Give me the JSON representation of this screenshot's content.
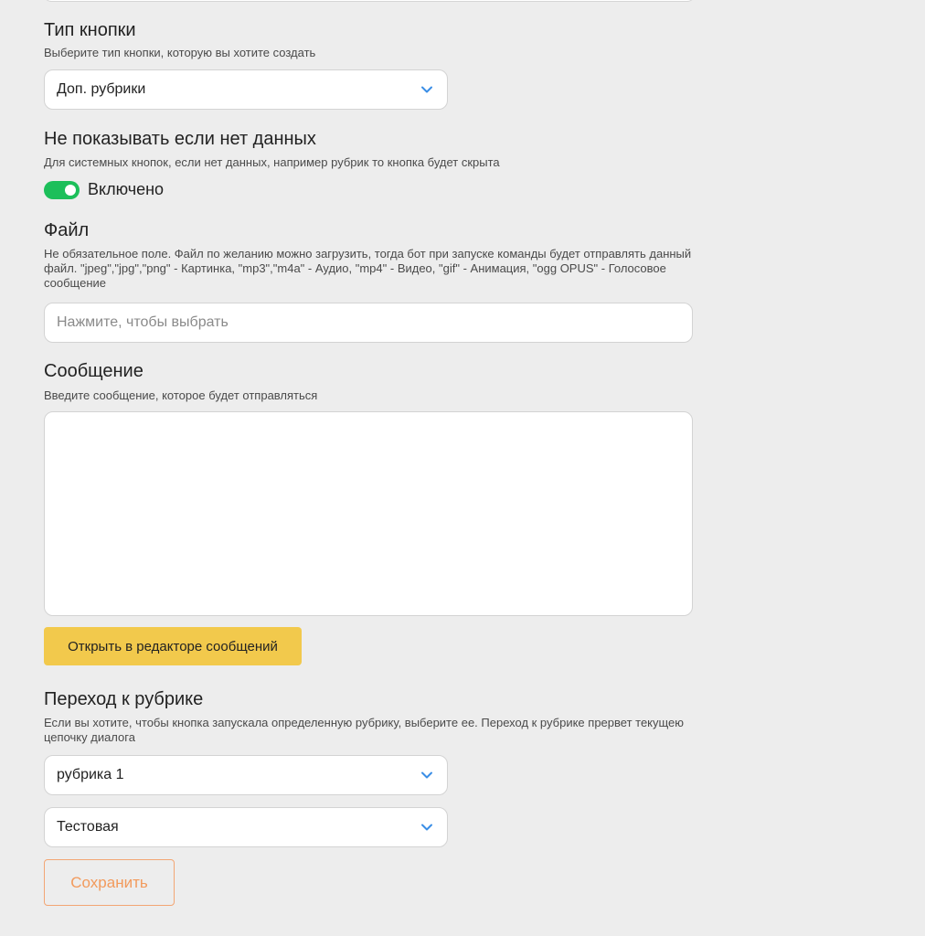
{
  "button_type": {
    "title": "Тип кнопки",
    "description": "Выберите тип кнопки, которую вы хотите создать",
    "selected": "Доп. рубрики"
  },
  "hide_if_empty": {
    "title": "Не показывать если нет данных",
    "description": "Для системных кнопок, если нет данных, например рубрик то кнопка будет скрыта",
    "toggle_on": true,
    "toggle_label": "Включено"
  },
  "file": {
    "title": "Файл",
    "description_line1": "Не обязательное поле. Файл по желанию можно загрузить, тогда бот при запуске команды будет отправлять данный",
    "description_line2": "файл. \"jpeg\",\"jpg\",\"png\" - Картинка, \"mp3\",\"m4a\" - Аудио, \"mp4\" - Видео, \"gif\" - Анимация, \"ogg OPUS\" - Голосовое",
    "description_line3": "сообщение",
    "placeholder": "Нажмите, чтобы выбрать"
  },
  "message": {
    "title": "Сообщение",
    "description": "Введите сообщение, которое будет отправляться",
    "value": "",
    "editor_button_label": "Открыть в редакторе сообщений"
  },
  "rubric_jump": {
    "title": "Переход к рубрике",
    "description_line1": "Если вы хотите, чтобы кнопка запускала определенную рубрику, выберите ее. Переход к рубрике прервет текущею",
    "description_line2": "цепочку диалога",
    "select1": "рубрика 1",
    "select2": "Тестовая"
  },
  "save_button_label": "Сохранить",
  "colors": {
    "background": "#ededed",
    "toggle_on": "#1cbf5a",
    "editor_button": "#f2c94c",
    "save_accent": "#f29a5c",
    "chevron": "#3a8ee6"
  },
  "icons": {
    "select_arrow": "chevron-down-icon"
  }
}
